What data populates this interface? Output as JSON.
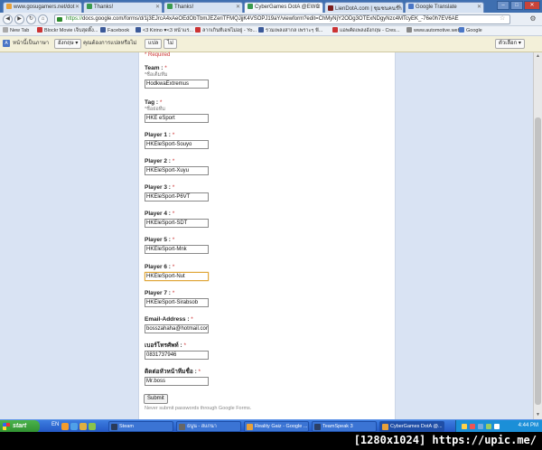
{
  "tabs": [
    {
      "label": "www.gosugamers.net/dot",
      "color": "#e8a13a",
      "active": false
    },
    {
      "label": "Thanks!",
      "color": "#3a9a4f",
      "active": false
    },
    {
      "label": "Thanks!",
      "color": "#3a9a4f",
      "active": false
    },
    {
      "label": "CyberGames DotA @EWC",
      "color": "#3a9a4f",
      "active": true
    },
    {
      "label": "LienDotA.com | ชุมชนคนรัก",
      "color": "#7a1d1d",
      "active": false
    },
    {
      "label": "Google Translate",
      "color": "#4a76c6",
      "active": false
    }
  ],
  "address": {
    "scheme": "https://",
    "rest": "docs.google.com/forms/d/1j3EJrcA4xAeOEdObTbmJEZeriTFMQJjjK4VSOPJ19aY/viewform?edit=ChMyNjY2ODg3OTExNDgyNzc4MTcyEK_-76e0h7EV6AE"
  },
  "bookmarks": [
    {
      "label": "New Tab",
      "color": "#aaa"
    },
    {
      "label": "Blockr Movie เจ็บสุดติ๊ง...",
      "color": "#c33"
    },
    {
      "label": "Facebook",
      "color": "#3b5998"
    },
    {
      "label": "<3 Kirino ♥<3 หน้าแร...",
      "color": "#3b5998"
    },
    {
      "label": "ลากเกินทีเอฟไม่อยู่ - Yo...",
      "color": "#c33"
    },
    {
      "label": "รวมเพลงสากล เพราะๆ ฟั...",
      "color": "#3b5998"
    },
    {
      "label": "แอพคัดเพลงอังกฤษ - Cres...",
      "color": "#c33"
    },
    {
      "label": "www.automotive.web...",
      "color": "#888"
    },
    {
      "label": "Google",
      "color": "#4a76c6"
    }
  ],
  "translate_bar": {
    "prefix": "หน้านี้เป็นภาษา",
    "language": "อังกฤษ",
    "question": "คุณต้องการแปลหรือไม่",
    "translate_btn": "แปล",
    "no_btn": "ไม่",
    "options_btn": "ตัวเลือก"
  },
  "form": {
    "required_note": "* Required",
    "fields": [
      {
        "label": "Team :",
        "help": "*ชื่อเต็มทีม",
        "value": "HodkwaExtremus",
        "focused": false
      },
      {
        "label": "Tag :",
        "help": "*ชื่อย่อทีม",
        "value": "HKE eSport",
        "focused": false
      },
      {
        "label": "Player 1 :",
        "help": "",
        "value": "HKEleSport-Souyo",
        "focused": false
      },
      {
        "label": "Player 2 :",
        "help": "",
        "value": "HKEleSport-Xuyu",
        "focused": false
      },
      {
        "label": "Player 3 :",
        "help": "",
        "value": "HKEleSport-P6VT",
        "focused": false
      },
      {
        "label": "Player 4 :",
        "help": "",
        "value": "HKEleSport-SDT",
        "focused": false
      },
      {
        "label": "Player 5 :",
        "help": "",
        "value": "HKEleSport-Mnk",
        "focused": false
      },
      {
        "label": "Player 6 :",
        "help": "",
        "value": "HKEleSport-Nut",
        "focused": true
      },
      {
        "label": "Player 7 :",
        "help": "",
        "value": "HKEleSport-Sirabsob",
        "focused": false
      },
      {
        "label": "Email-Address :",
        "help": "",
        "value": "bosszahaha@hotmail.com",
        "focused": false
      },
      {
        "label": "เบอร์โทรศัพท์ :",
        "help": "",
        "value": "0831737946",
        "focused": false
      },
      {
        "label": "ติดต่อหัวหน้าทีมชื่อ :",
        "help": "",
        "value": "Mr.boss",
        "focused": false
      }
    ],
    "submit_label": "Submit",
    "never_note": "Never submit passwords through Google Forms."
  },
  "taskbar": {
    "start_label": "start",
    "lang": "EN",
    "tasks": [
      {
        "label": "Steam",
        "color": "#2a3b5a",
        "active": false
      },
      {
        "label": "ธนูน - สแกนา",
        "color": "#666",
        "active": false
      },
      {
        "label": "Reality Gaiz - Google ...",
        "color": "#e8a13a",
        "active": false
      },
      {
        "label": "TeamSpeak 3",
        "color": "#2b3f66",
        "active": false
      },
      {
        "label": "CyberGames DotA @...",
        "color": "#e8a13a",
        "active": true
      }
    ],
    "clock": "4:44 PM"
  },
  "resolution_text": "[1280x1024] https://upic.me/"
}
